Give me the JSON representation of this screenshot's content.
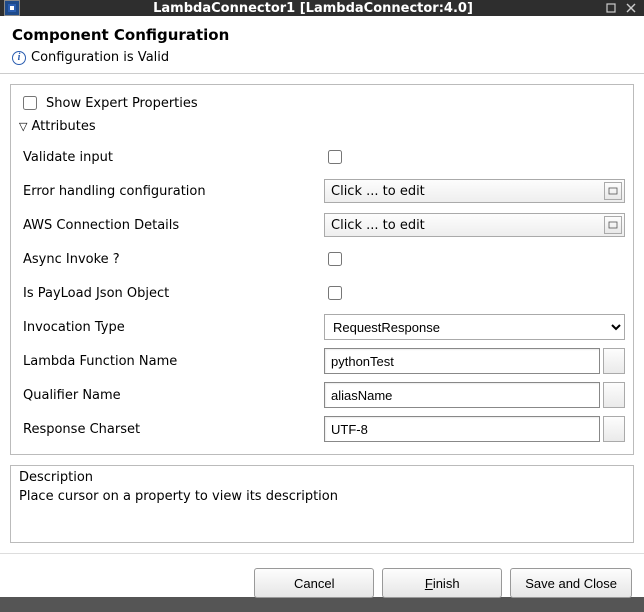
{
  "window": {
    "title": "LambdaConnector1 [LambdaConnector:4.0]"
  },
  "header": {
    "title": "Component Configuration",
    "status": "Configuration is Valid"
  },
  "expert": {
    "label": "Show Expert Properties",
    "checked": false
  },
  "section": {
    "label": "Attributes"
  },
  "props": {
    "validate_input": {
      "label": "Validate input",
      "checked": false
    },
    "error_handling": {
      "label": "Error handling configuration",
      "display": "Click ... to edit"
    },
    "aws_conn": {
      "label": "AWS Connection Details",
      "display": "Click ... to edit"
    },
    "async_invoke": {
      "label": "Async Invoke ?",
      "checked": false
    },
    "payload_json": {
      "label": "Is PayLoad Json Object",
      "checked": false
    },
    "invocation_type": {
      "label": "Invocation Type",
      "value": "RequestResponse"
    },
    "lambda_fn": {
      "label": "Lambda Function Name",
      "value": "pythonTest"
    },
    "qualifier": {
      "label": "Qualifier Name",
      "value": "aliasName"
    },
    "charset": {
      "label": "Response Charset",
      "value": "UTF-8"
    }
  },
  "description": {
    "title": "Description",
    "text": "Place cursor on a property to view its description"
  },
  "buttons": {
    "cancel": "Cancel",
    "finish": "Finish",
    "save_close": "Save and Close"
  }
}
